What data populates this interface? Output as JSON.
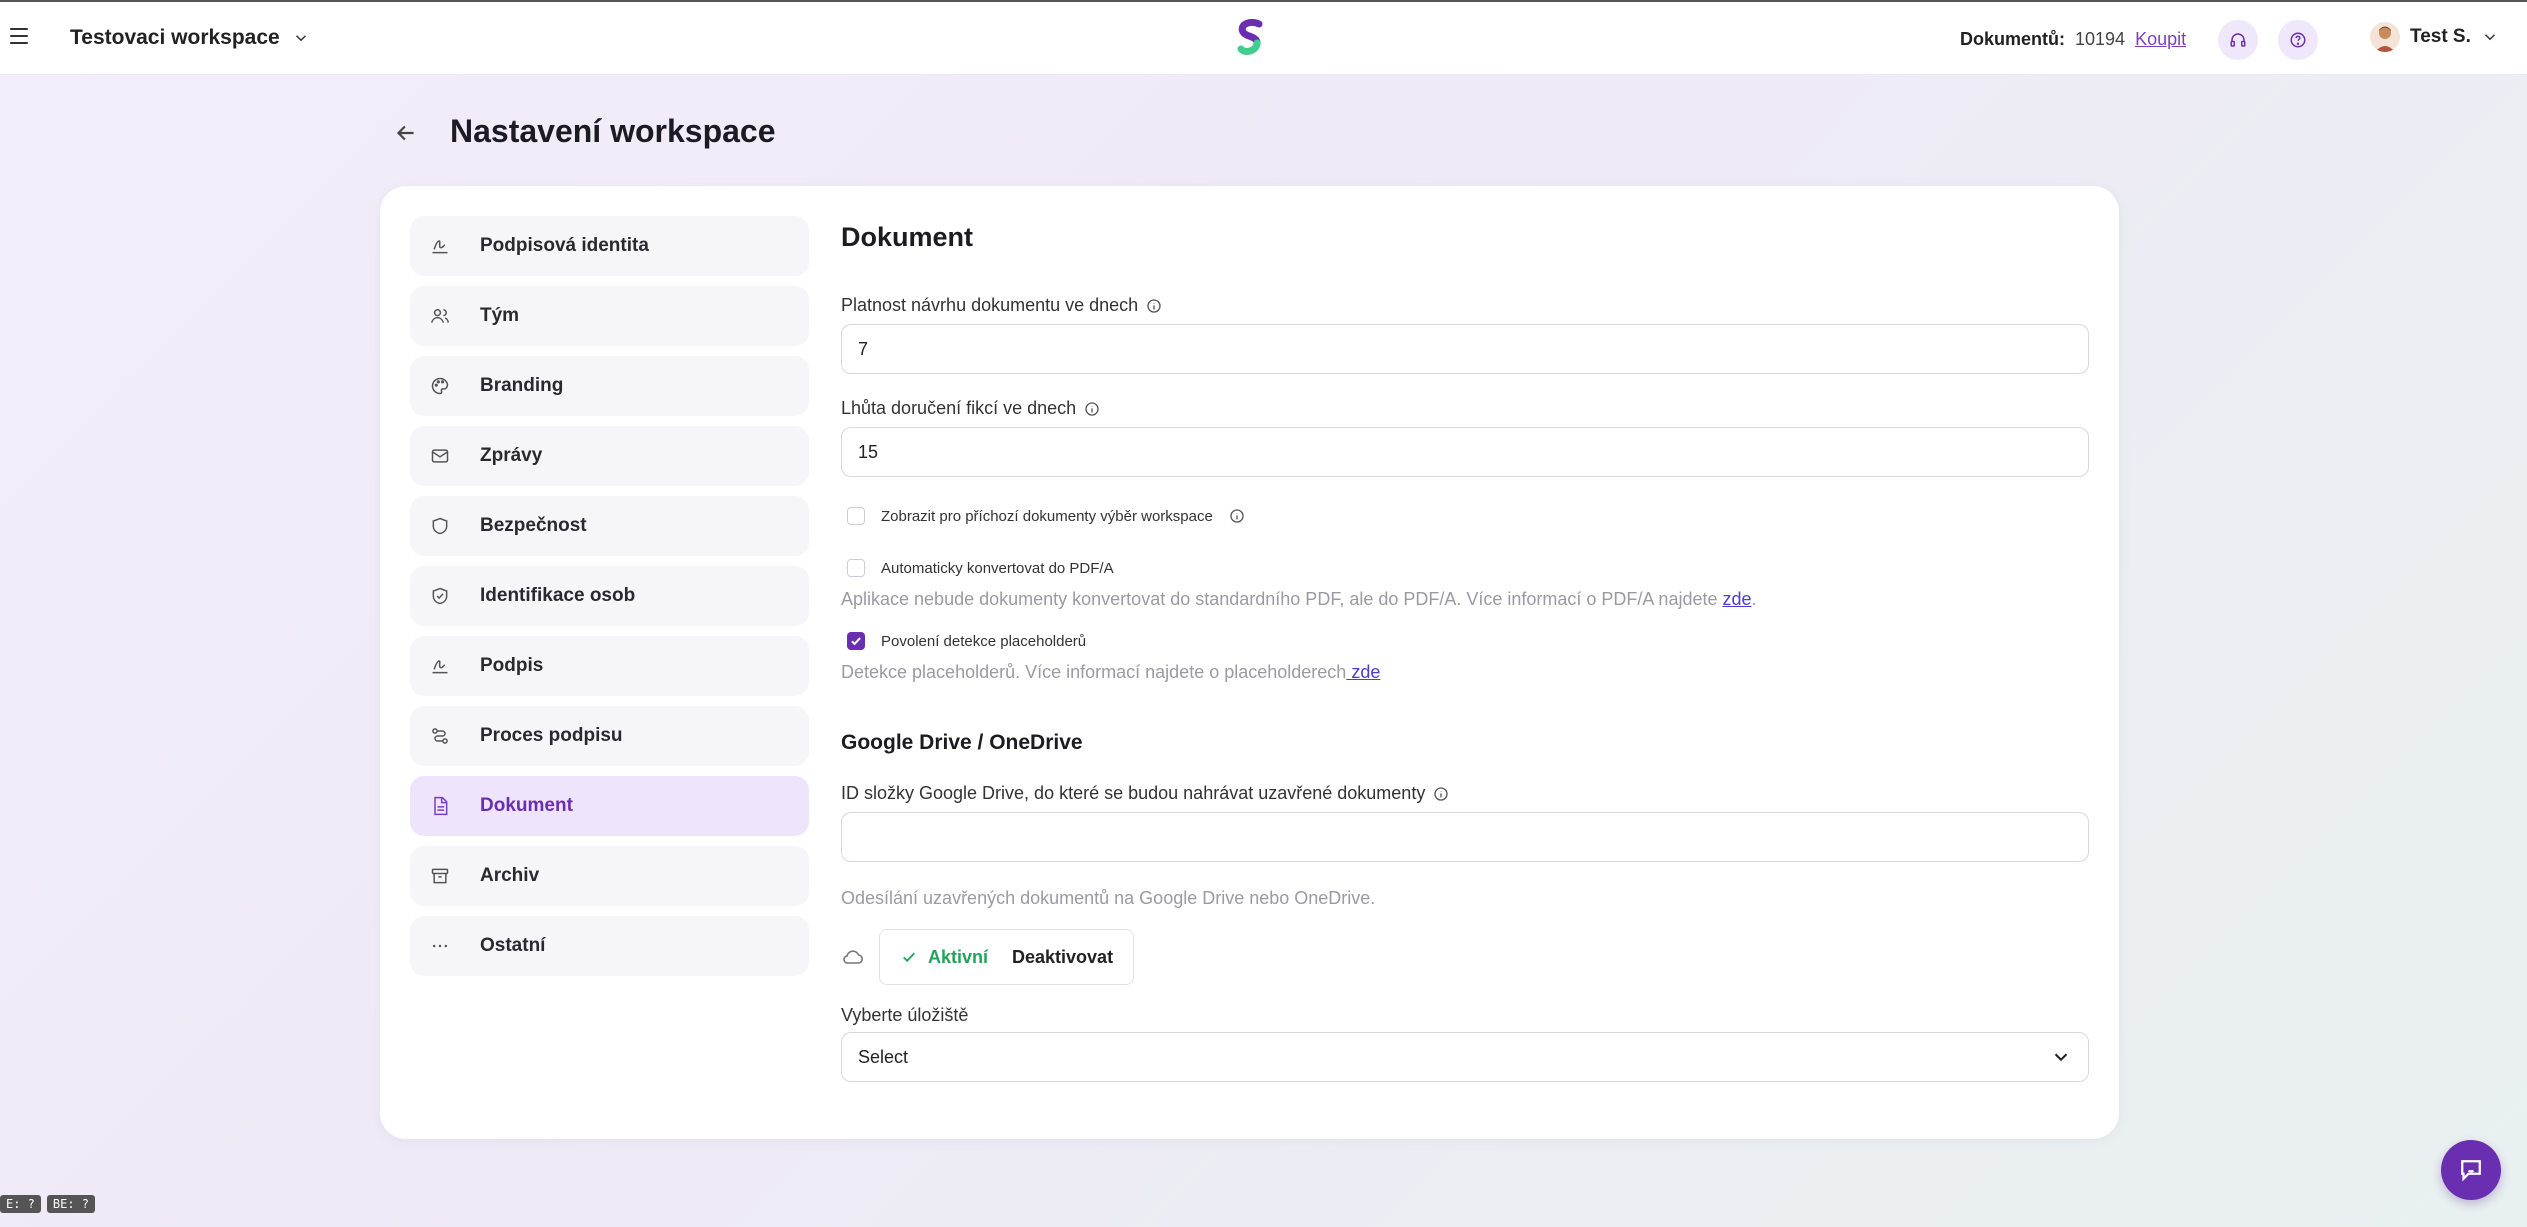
{
  "topbar": {
    "workspace_name": "Testovaci workspace",
    "documents_label": "Dokumentů:",
    "documents_count": "10194",
    "buy_label": "Koupit",
    "user_name": "Test S."
  },
  "page": {
    "title": "Nastavení workspace"
  },
  "sidebar": {
    "items": [
      {
        "label": "Podpisová identita",
        "icon": "signature-icon"
      },
      {
        "label": "Tým",
        "icon": "users-icon"
      },
      {
        "label": "Branding",
        "icon": "palette-icon"
      },
      {
        "label": "Zprávy",
        "icon": "mail-icon"
      },
      {
        "label": "Bezpečnost",
        "icon": "shield-icon"
      },
      {
        "label": "Identifikace osob",
        "icon": "shield-check-icon"
      },
      {
        "label": "Podpis",
        "icon": "signature-icon"
      },
      {
        "label": "Proces podpisu",
        "icon": "route-icon"
      },
      {
        "label": "Dokument",
        "icon": "document-icon",
        "active": true
      },
      {
        "label": "Archiv",
        "icon": "archive-icon"
      },
      {
        "label": "Ostatní",
        "icon": "ellipsis-icon"
      }
    ]
  },
  "content": {
    "section_title": "Dokument",
    "validity_label": "Platnost návrhu dokumentu ve dnech",
    "validity_value": "7",
    "delivery_label": "Lhůta doručení fikcí ve dnech",
    "delivery_value": "15",
    "show_workspace_label": "Zobrazit pro příchozí dokumenty výběr workspace",
    "show_workspace_checked": false,
    "pdfa_label": "Automaticky konvertovat do PDF/A",
    "pdfa_checked": false,
    "pdfa_hint": "Aplikace nebude dokumenty konvertovat do standardního PDF, ale do PDF/A. Více informací o PDF/A najdete ",
    "pdfa_hint_link": "zde",
    "pdfa_hint_end": ".",
    "placeholder_label": "Povolení detekce placeholderů",
    "placeholder_checked": true,
    "placeholder_hint": "Detekce placeholderů. Více informací najdete o placeholderech",
    "placeholder_hint_link": " zde",
    "gdrive_title": "Google Drive / OneDrive",
    "gdrive_folder_label": "ID složky Google Drive, do které se budou nahrávat uzavřené dokumenty",
    "gdrive_folder_value": "",
    "gdrive_hint": "Odesílání uzavřených dokumentů na Google Drive nebo OneDrive.",
    "active_label": "Aktivní",
    "deactivate_label": "Deaktivovat",
    "storage_label": "Vyberte úložiště",
    "storage_value": "Select"
  },
  "debug": [
    "E: ?",
    "BE: ?"
  ],
  "colors": {
    "accent": "#6a2fb0",
    "active_green": "#22a35b",
    "link": "#4b3bd6"
  }
}
